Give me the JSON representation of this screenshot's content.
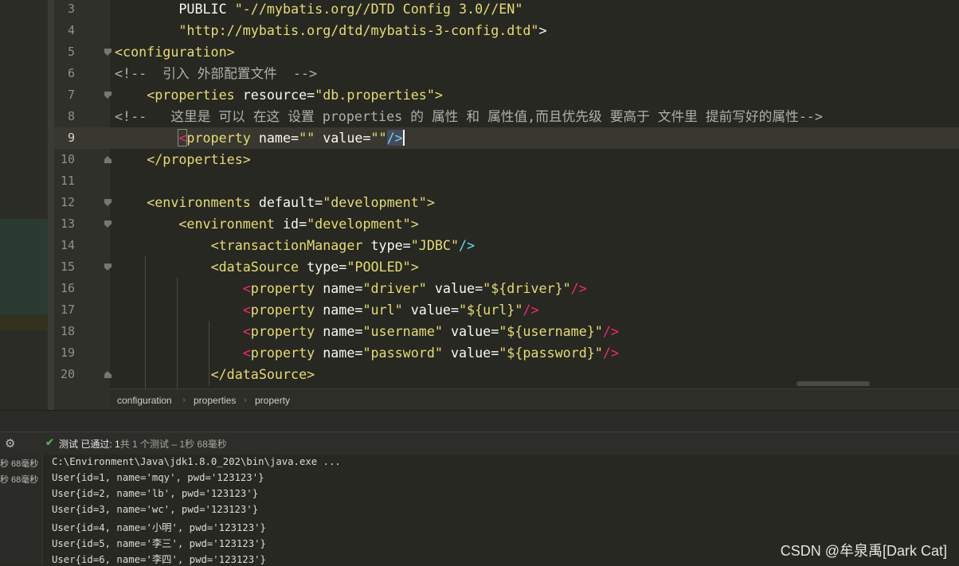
{
  "editor": {
    "lines": [
      {
        "num": "3",
        "tokens": [
          {
            "t": "PUBLIC ",
            "c": "#f8f8f2"
          },
          {
            "t": "\"-//mybatis.org//DTD Config 3.0//EN\"",
            "c": "#e6db74"
          }
        ]
      },
      {
        "num": "4",
        "tokens": [
          {
            "t": "\"http://mybatis.org/dtd/mybatis-3-config.dtd\"",
            "c": "#e6db74"
          },
          {
            "t": ">",
            "c": "#f8f8f2"
          }
        ]
      },
      {
        "num": "5",
        "tokens": [
          {
            "t": "<configuration>",
            "c": "#e6db74"
          }
        ]
      },
      {
        "num": "6",
        "tokens": [
          {
            "t": "<!--  引入 外部配置文件  -->",
            "c": "#b0b0a8"
          }
        ]
      },
      {
        "num": "7",
        "tokens": [
          {
            "t": "<properties ",
            "c": "#e6db74"
          },
          {
            "t": "resource=",
            "c": "#f8f8f2"
          },
          {
            "t": "\"db.properties\"",
            "c": "#e6db74"
          },
          {
            "t": ">",
            "c": "#e6db74"
          }
        ]
      },
      {
        "num": "8",
        "tokens": [
          {
            "t": "<!--   这里是 可以 在这 设置 properties 的 属性 和 属性值,而且优先级 要高于 文件里 提前写好的属性-->",
            "c": "#b0b0a8"
          }
        ]
      },
      {
        "num": "9",
        "tokens": [
          {
            "t": "<",
            "c": "#f92672",
            "br": true
          },
          {
            "t": "property ",
            "c": "#e6db74"
          },
          {
            "t": "name=",
            "c": "#f8f8f2"
          },
          {
            "t": "\"\"",
            "c": "#e6db74"
          },
          {
            "t": " value=",
            "c": "#f8f8f2"
          },
          {
            "t": "\"\"",
            "c": "#e6db74"
          },
          {
            "t": "/>",
            "c": "#66d9ef",
            "br2": true
          },
          {
            "t": "",
            "c": "caret"
          }
        ]
      },
      {
        "num": "10",
        "tokens": [
          {
            "t": "</properties>",
            "c": "#e6db74"
          }
        ]
      },
      {
        "num": "11",
        "tokens": []
      },
      {
        "num": "12",
        "tokens": [
          {
            "t": "<environments ",
            "c": "#e6db74"
          },
          {
            "t": "default=",
            "c": "#f8f8f2"
          },
          {
            "t": "\"development\"",
            "c": "#e6db74"
          },
          {
            "t": ">",
            "c": "#e6db74"
          }
        ]
      },
      {
        "num": "13",
        "tokens": [
          {
            "t": "<environment ",
            "c": "#e6db74"
          },
          {
            "t": "id=",
            "c": "#f8f8f2"
          },
          {
            "t": "\"development\"",
            "c": "#e6db74"
          },
          {
            "t": ">",
            "c": "#e6db74"
          }
        ]
      },
      {
        "num": "14",
        "tokens": [
          {
            "t": "<transactionManager ",
            "c": "#e6db74"
          },
          {
            "t": "type=",
            "c": "#f8f8f2"
          },
          {
            "t": "\"JDBC\"",
            "c": "#e6db74"
          },
          {
            "t": "/>",
            "c": "#66d9ef"
          }
        ]
      },
      {
        "num": "15",
        "tokens": [
          {
            "t": "<dataSource ",
            "c": "#e6db74"
          },
          {
            "t": "type=",
            "c": "#f8f8f2"
          },
          {
            "t": "\"POOLED\"",
            "c": "#e6db74"
          },
          {
            "t": ">",
            "c": "#e6db74"
          }
        ]
      },
      {
        "num": "16",
        "tokens": [
          {
            "t": "<",
            "c": "#f92672"
          },
          {
            "t": "property ",
            "c": "#e6db74"
          },
          {
            "t": "name=",
            "c": "#f8f8f2"
          },
          {
            "t": "\"driver\"",
            "c": "#e6db74"
          },
          {
            "t": " value=",
            "c": "#f8f8f2"
          },
          {
            "t": "\"${driver}\"",
            "c": "#e6db74"
          },
          {
            "t": "/>",
            "c": "#f92672"
          }
        ]
      },
      {
        "num": "17",
        "tokens": [
          {
            "t": "<",
            "c": "#f92672"
          },
          {
            "t": "property ",
            "c": "#e6db74"
          },
          {
            "t": "name=",
            "c": "#f8f8f2"
          },
          {
            "t": "\"url\"",
            "c": "#e6db74"
          },
          {
            "t": " value=",
            "c": "#f8f8f2"
          },
          {
            "t": "\"${url}\"",
            "c": "#e6db74"
          },
          {
            "t": "/>",
            "c": "#f92672"
          }
        ]
      },
      {
        "num": "18",
        "tokens": [
          {
            "t": "<",
            "c": "#f92672"
          },
          {
            "t": "property ",
            "c": "#e6db74"
          },
          {
            "t": "name=",
            "c": "#f8f8f2"
          },
          {
            "t": "\"username\"",
            "c": "#e6db74"
          },
          {
            "t": " value=",
            "c": "#f8f8f2"
          },
          {
            "t": "\"${username}\"",
            "c": "#e6db74"
          },
          {
            "t": "/>",
            "c": "#f92672"
          }
        ]
      },
      {
        "num": "19",
        "tokens": [
          {
            "t": "<",
            "c": "#f92672"
          },
          {
            "t": "property ",
            "c": "#e6db74"
          },
          {
            "t": "name=",
            "c": "#f8f8f2"
          },
          {
            "t": "\"password\"",
            "c": "#e6db74"
          },
          {
            "t": " value=",
            "c": "#f8f8f2"
          },
          {
            "t": "\"${password}\"",
            "c": "#e6db74"
          },
          {
            "t": "/>",
            "c": "#f92672"
          }
        ]
      },
      {
        "num": "20",
        "tokens": [
          {
            "t": "</dataSource>",
            "c": "#e6db74"
          }
        ]
      }
    ],
    "breadcrumb": [
      "configuration",
      "properties",
      "property"
    ]
  },
  "run": {
    "status_label": "测试 已通过: ",
    "status_count": "1",
    "status_rest": "共 1 个测试 – 1秒 68毫秒",
    "tree_items": [
      "秒 68毫秒",
      "秒 68毫秒"
    ],
    "console_lines": [
      "C:\\Environment\\Java\\jdk1.8.0_202\\bin\\java.exe ...",
      "User{id=1, name='mqy', pwd='123123'}",
      "User{id=2, name='lb', pwd='123123'}",
      "User{id=3, name='wc', pwd='123123'}",
      "User{id=4, name='小明', pwd='123123'}",
      "User{id=5, name='李三', pwd='123123'}",
      "User{id=6, name='李四', pwd='123123'}"
    ]
  },
  "watermark": "CSDN @牟泉禹[Dark Cat]",
  "colors": {
    "background": "#272822",
    "tag": "#e6db74",
    "bracket": "#f92672",
    "selfclose": "#66d9ef",
    "comment": "#b0b0a8",
    "success": "#4caf50"
  }
}
